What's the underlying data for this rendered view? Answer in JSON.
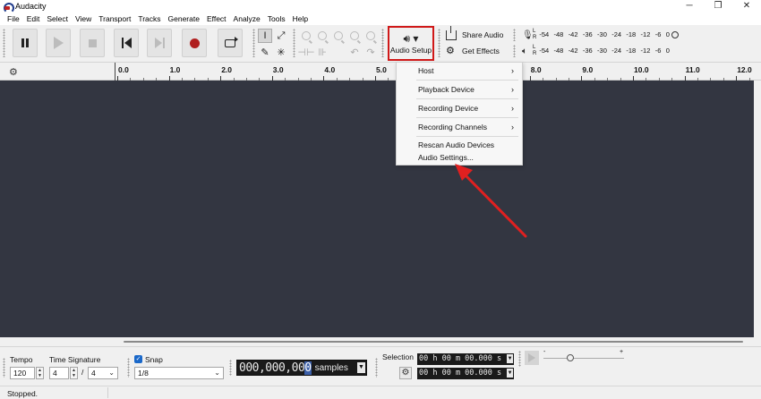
{
  "window": {
    "title": "Audacity",
    "minimize": "─",
    "maximize": "❐",
    "close": "✕"
  },
  "menubar": [
    "File",
    "Edit",
    "Select",
    "View",
    "Transport",
    "Tracks",
    "Generate",
    "Effect",
    "Analyze",
    "Tools",
    "Help"
  ],
  "toolbar": {
    "audio_setup_label": "Audio Setup",
    "audio_setup_icon": "speaker-icon",
    "share_audio_label": "Share Audio",
    "get_effects_label": "Get Effects"
  },
  "meters": {
    "scale": [
      "-54",
      "-48",
      "-42",
      "-36",
      "-30",
      "-24",
      "-18",
      "-12",
      "-6",
      "0"
    ],
    "left": "L",
    "right": "R"
  },
  "ruler": {
    "labels": [
      {
        "text": "0.0",
        "value": 0
      },
      {
        "text": "1.0",
        "value": 1
      },
      {
        "text": "2.0",
        "value": 2
      },
      {
        "text": "3.0",
        "value": 3
      },
      {
        "text": "4.0",
        "value": 4
      },
      {
        "text": "5.0",
        "value": 5
      },
      {
        "text": "8.0",
        "value": 8
      },
      {
        "text": "9.0",
        "value": 9
      },
      {
        "text": "10.0",
        "value": 10
      },
      {
        "text": "11.0",
        "value": 11
      },
      {
        "text": "12.0",
        "value": 12
      }
    ]
  },
  "dropdown": {
    "items": [
      {
        "label": "Host",
        "submenu": true
      },
      {
        "label": "Playback Device",
        "submenu": true
      },
      {
        "label": "Recording Device",
        "submenu": true
      },
      {
        "label": "Recording Channels",
        "submenu": true
      },
      {
        "label": "Rescan Audio Devices",
        "submenu": false
      },
      {
        "label": "Audio Settings...",
        "submenu": false
      }
    ],
    "arrow": "›"
  },
  "bottom": {
    "tempo_label": "Tempo",
    "tempo_value": "120",
    "time_signature_label": "Time Signature",
    "time_sig_upper": "4",
    "time_sig_slash": "/",
    "time_sig_lower": "4",
    "snap_label": "Snap",
    "snap_checked": "✓",
    "snap_value": "1/8",
    "time_digits_before": "000,000,00",
    "time_digits_highlight": "0",
    "time_unit": "samples",
    "selection_label": "Selection",
    "selection_start": "00 h 00 m 00.000 s",
    "selection_end": "00 h 00 m 00.000 s",
    "speed_min": "-",
    "speed_max": "+"
  },
  "status": {
    "text": "Stopped."
  },
  "colors": {
    "highlight_border": "#d01919",
    "annotation_arrow": "#e02020",
    "track_bg": "#333641",
    "record": "#b01f1f"
  }
}
